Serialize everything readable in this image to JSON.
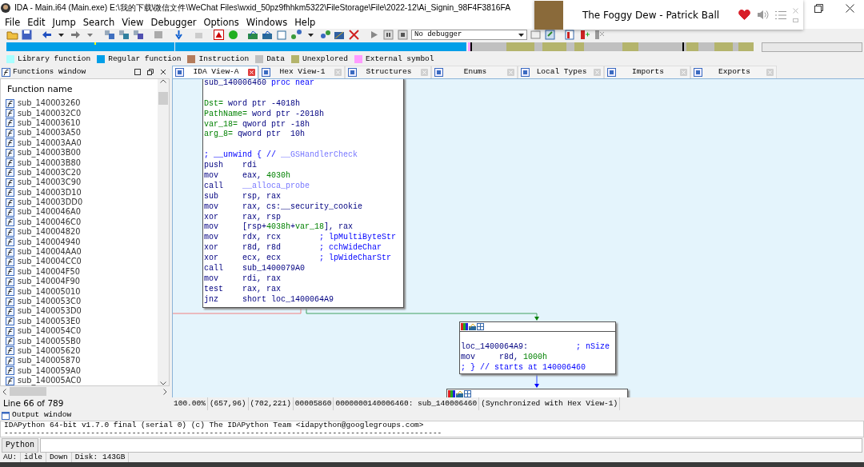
{
  "window": {
    "title": "IDA - Main.i64 (Main.exe) E:\\我的下载\\微信文件\\WeChat Files\\wxid_50pz9fhhkm5322\\FileStorage\\File\\2022-12\\Ai_Signin_98F4F3816FA"
  },
  "now_playing": {
    "title": "The Foggy Dew - Patrick Ball",
    "liked": true
  },
  "menu": [
    "File",
    "Edit",
    "Jump",
    "Search",
    "View",
    "Debugger",
    "Options",
    "Windows",
    "Help"
  ],
  "toolbar": {
    "debugger": "No debugger"
  },
  "legend": [
    {
      "label": "Library function",
      "color": "#a8ffff"
    },
    {
      "label": "Regular function",
      "color": "#009fe8"
    },
    {
      "label": "Instruction",
      "color": "#b47c5c"
    },
    {
      "label": "Data",
      "color": "#c0c0c0"
    },
    {
      "label": "Unexplored",
      "color": "#b4b46c"
    },
    {
      "label": "External symbol",
      "color": "#ff9cff"
    }
  ],
  "functions_window": {
    "title": "Functions window",
    "column": "Function name",
    "status": "Line 66 of 789",
    "items": [
      "sub_140003260",
      "sub_1400032C0",
      "sub_140003610",
      "sub_140003A50",
      "sub_140003AA0",
      "sub_140003B00",
      "sub_140003B80",
      "sub_140003C20",
      "sub_140003C90",
      "sub_140003D10",
      "sub_140003DD0",
      "sub_1400046A0",
      "sub_1400046C0",
      "sub_140004820",
      "sub_140004940",
      "sub_140004AA0",
      "sub_140004CC0",
      "sub_140004F50",
      "sub_140004F90",
      "sub_140005010",
      "sub_1400053C0",
      "sub_1400053D0",
      "sub_1400053E0",
      "sub_1400054C0",
      "sub_1400055B0",
      "sub_140005620",
      "sub_140005870",
      "sub_1400059A0",
      "sub_140005AC0"
    ]
  },
  "tabs": [
    {
      "label": "IDA View-A",
      "selected": true
    },
    {
      "label": "Hex View-1",
      "selected": false
    },
    {
      "label": "Structures",
      "selected": false
    },
    {
      "label": "Enums",
      "selected": false
    },
    {
      "label": "Local Types",
      "selected": false
    },
    {
      "label": "Imports",
      "selected": false
    },
    {
      "label": "Exports",
      "selected": false
    }
  ],
  "graph": {
    "nodes": [
      {
        "header": false,
        "lines": [
          {
            "kind": "code",
            "segments": [
              {
                "text": "sub_140006460 ",
                "kind": "ins"
              },
              {
                "text": "proc near",
                "kind": "cmt"
              }
            ]
          },
          {
            "kind": "blank"
          },
          {
            "kind": "code",
            "segments": [
              {
                "text": "Dst=",
                "kind": "var"
              },
              {
                "text": " word ptr -4018h",
                "kind": "ins"
              }
            ]
          },
          {
            "kind": "code",
            "segments": [
              {
                "text": "PathName=",
                "kind": "var"
              },
              {
                "text": " word ptr -2018h",
                "kind": "ins"
              }
            ]
          },
          {
            "kind": "code",
            "segments": [
              {
                "text": "var_18=",
                "kind": "var"
              },
              {
                "text": " qword ptr -18h",
                "kind": "ins"
              }
            ]
          },
          {
            "kind": "code",
            "segments": [
              {
                "text": "arg_8=",
                "kind": "var"
              },
              {
                "text": " qword ptr  10h",
                "kind": "ins"
              }
            ]
          },
          {
            "kind": "blank"
          },
          {
            "kind": "code",
            "segments": [
              {
                "text": "; __unwind { // ",
                "kind": "cmt"
              },
              {
                "text": "__GSHandlerCheck",
                "kind": "imp"
              }
            ]
          },
          {
            "kind": "code",
            "segments": [
              {
                "text": "push    rdi",
                "kind": "ins"
              }
            ]
          },
          {
            "kind": "code",
            "segments": [
              {
                "text": "mov     eax, ",
                "kind": "ins"
              },
              {
                "text": "4030h",
                "kind": "num"
              }
            ]
          },
          {
            "kind": "code",
            "segments": [
              {
                "text": "call    ",
                "kind": "ins"
              },
              {
                "text": "__alloca_probe",
                "kind": "imp"
              }
            ]
          },
          {
            "kind": "code",
            "segments": [
              {
                "text": "sub     rsp, rax",
                "kind": "ins"
              }
            ]
          },
          {
            "kind": "code",
            "segments": [
              {
                "text": "mov     rax, cs:__security_cookie",
                "kind": "ins"
              }
            ]
          },
          {
            "kind": "code",
            "segments": [
              {
                "text": "xor     rax, rsp",
                "kind": "ins"
              }
            ]
          },
          {
            "kind": "code",
            "segments": [
              {
                "text": "mov     [rsp+",
                "kind": "ins"
              },
              {
                "text": "4038h",
                "kind": "num"
              },
              {
                "text": "+",
                "kind": "ins"
              },
              {
                "text": "var_18",
                "kind": "var"
              },
              {
                "text": "], rax",
                "kind": "ins"
              }
            ]
          },
          {
            "kind": "code",
            "segments": [
              {
                "text": "mov     rdx, rcx        ",
                "kind": "ins"
              },
              {
                "text": "; lpMultiByteStr",
                "kind": "cmt"
              }
            ]
          },
          {
            "kind": "code",
            "segments": [
              {
                "text": "xor     r8d, r8d        ",
                "kind": "ins"
              },
              {
                "text": "; cchWideChar",
                "kind": "cmt"
              }
            ]
          },
          {
            "kind": "code",
            "segments": [
              {
                "text": "xor     ecx, ecx        ",
                "kind": "ins"
              },
              {
                "text": "; lpWideCharStr",
                "kind": "cmt"
              }
            ]
          },
          {
            "kind": "code",
            "segments": [
              {
                "text": "call    sub_1400079A0",
                "kind": "ins"
              }
            ]
          },
          {
            "kind": "code",
            "segments": [
              {
                "text": "mov     rdi, rax",
                "kind": "ins"
              }
            ]
          },
          {
            "kind": "code",
            "segments": [
              {
                "text": "test    rax, rax",
                "kind": "ins"
              }
            ]
          },
          {
            "kind": "code",
            "segments": [
              {
                "text": "jnz     short loc_1400064A9",
                "kind": "ins"
              }
            ]
          }
        ]
      },
      {
        "header": true,
        "lines": [
          {
            "kind": "blank"
          },
          {
            "kind": "code",
            "segments": [
              {
                "text": "loc_1400064A9:          ",
                "kind": "ins"
              },
              {
                "text": "; nSize",
                "kind": "cmt"
              }
            ]
          },
          {
            "kind": "code",
            "segments": [
              {
                "text": "mov     r8d, ",
                "kind": "ins"
              },
              {
                "text": "1000h",
                "kind": "num"
              }
            ]
          },
          {
            "kind": "code",
            "segments": [
              {
                "text": "; } // starts at 140006460",
                "kind": "cmt"
              }
            ]
          }
        ]
      },
      {
        "header": true
      }
    ]
  },
  "graph_status": [
    "100.00%",
    "(657,96)",
    "(702,221)",
    "00005860",
    "0000000140006460: sub_140006460",
    "(Synchronized with Hex View-1)"
  ],
  "output_window": {
    "title": "Output window",
    "lines": [
      "IDAPython 64-bit v1.7.0 final (serial 0) (c) The IDAPython Team <idapython@googlegroups.com>",
      "------------------------------------------------------------------------------------------------"
    ]
  },
  "command": {
    "language": "Python"
  },
  "status_bar": [
    "AU:",
    "idle",
    "Down",
    "Disk: 143GB"
  ]
}
